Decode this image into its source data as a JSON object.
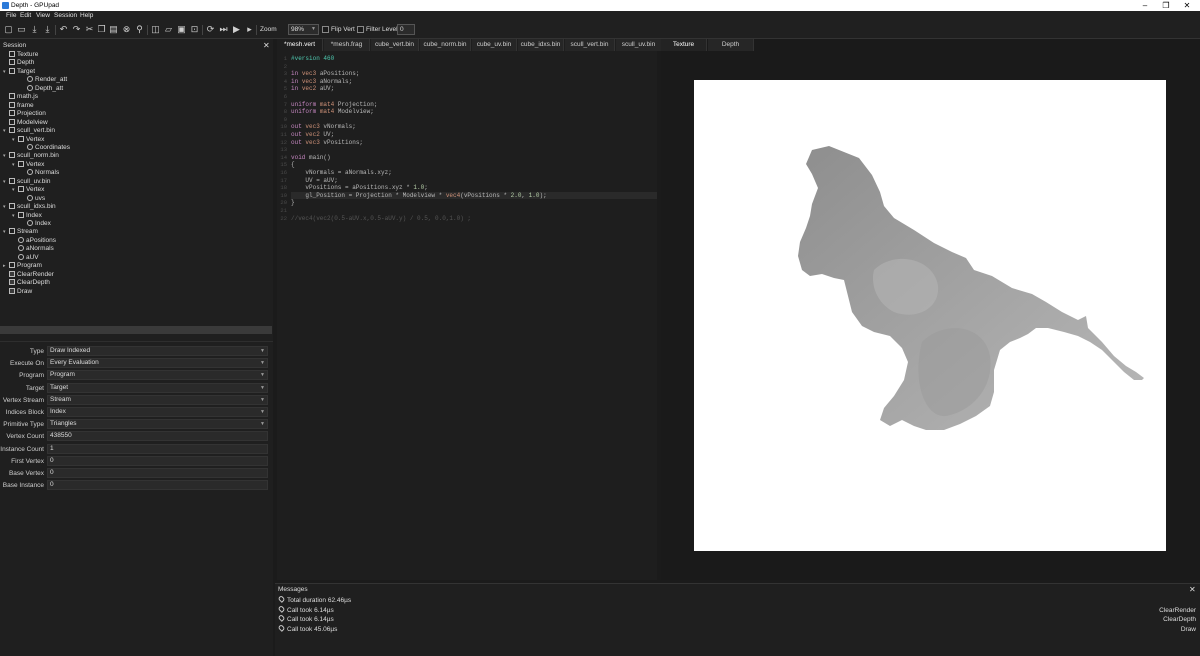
{
  "window": {
    "title": "Depth - GPUpad"
  },
  "menu": [
    "File",
    "Edit",
    "View",
    "Session",
    "Help"
  ],
  "toolbar": {
    "zoom_label": "Zoom",
    "zoom_value": "98%",
    "flip_vert": "Flip Vert",
    "filter": "Filter",
    "level_label": "Level",
    "level_value": "0"
  },
  "session": {
    "title": "Session",
    "items": [
      {
        "label": "Texture",
        "depth": 0,
        "icon": "texture-icon"
      },
      {
        "label": "Depth",
        "depth": 0,
        "icon": "texture-icon"
      },
      {
        "label": "Target",
        "depth": 0,
        "icon": "target-icon",
        "expanded": true
      },
      {
        "label": "Render_att",
        "depth": 2,
        "icon": "link-icon"
      },
      {
        "label": "Depth_att",
        "depth": 2,
        "icon": "link-icon"
      },
      {
        "label": "math.js",
        "depth": 0,
        "icon": "script-icon"
      },
      {
        "label": "frame",
        "depth": 0,
        "icon": "binding-icon"
      },
      {
        "label": "Projection",
        "depth": 0,
        "icon": "binding-icon"
      },
      {
        "label": "Modelview",
        "depth": 0,
        "icon": "binding-icon"
      },
      {
        "label": "scull_vert.bin",
        "depth": 0,
        "icon": "buffer-icon",
        "expanded": true
      },
      {
        "label": "Vertex",
        "depth": 1,
        "icon": "block-icon",
        "expanded": true
      },
      {
        "label": "Coordinates",
        "depth": 2,
        "icon": "link-icon"
      },
      {
        "label": "scull_norm.bin",
        "depth": 0,
        "icon": "buffer-icon",
        "expanded": true
      },
      {
        "label": "Vertex",
        "depth": 1,
        "icon": "block-icon",
        "expanded": true
      },
      {
        "label": "Normals",
        "depth": 2,
        "icon": "link-icon"
      },
      {
        "label": "scull_uv.bin",
        "depth": 0,
        "icon": "buffer-icon",
        "expanded": true
      },
      {
        "label": "Vertex",
        "depth": 1,
        "icon": "block-icon",
        "expanded": true
      },
      {
        "label": "uvs",
        "depth": 2,
        "icon": "link-icon"
      },
      {
        "label": "scull_idxs.bin",
        "depth": 0,
        "icon": "buffer-icon",
        "expanded": true
      },
      {
        "label": "Index",
        "depth": 1,
        "icon": "block-icon",
        "expanded": true
      },
      {
        "label": "Index",
        "depth": 2,
        "icon": "link-icon"
      },
      {
        "label": "Stream",
        "depth": 0,
        "icon": "stream-icon",
        "expanded": true
      },
      {
        "label": "aPositions",
        "depth": 1,
        "icon": "link-icon"
      },
      {
        "label": "aNormals",
        "depth": 1,
        "icon": "link-icon"
      },
      {
        "label": "aUV",
        "depth": 1,
        "icon": "link-icon"
      },
      {
        "label": "Program",
        "depth": 0,
        "icon": "program-icon",
        "collapsed": true
      },
      {
        "label": "ClearRender",
        "depth": 0,
        "icon": "check-icon"
      },
      {
        "label": "ClearDepth",
        "depth": 0,
        "icon": "check-icon"
      },
      {
        "label": "Draw",
        "depth": 0,
        "icon": "check-icon",
        "selected": true
      }
    ]
  },
  "properties": [
    {
      "label": "Type",
      "value": "Draw Indexed",
      "dropdown": true
    },
    {
      "label": "Execute On",
      "value": "Every Evaluation",
      "dropdown": true
    },
    {
      "label": "Program",
      "value": "Program",
      "dropdown": true
    },
    {
      "label": "Target",
      "value": "Target",
      "dropdown": true
    },
    {
      "label": "Vertex Stream",
      "value": "Stream",
      "dropdown": true
    },
    {
      "label": "Indices Block",
      "value": "Index",
      "dropdown": true
    },
    {
      "label": "Primitive Type",
      "value": "Triangles",
      "dropdown": true
    },
    {
      "label": "Vertex Count",
      "value": "438550",
      "dropdown": false
    },
    {
      "label": "Instance Count",
      "value": "1",
      "dropdown": false
    },
    {
      "label": "First Vertex",
      "value": "0",
      "dropdown": false
    },
    {
      "label": "Base Vertex",
      "value": "0",
      "dropdown": false
    },
    {
      "label": "Base Instance",
      "value": "0",
      "dropdown": false
    }
  ],
  "editor": {
    "tabs": [
      "*mesh.vert",
      "*mesh.frag",
      "cube_vert.bin",
      "cube_norm.bin",
      "cube_uv.bin",
      "cube_idxs.bin",
      "scull_vert.bin",
      "scull_uv.bin"
    ],
    "lines": [
      "#version 460",
      "",
      "in vec3 aPositions;",
      "in vec3 aNormals;",
      "in vec2 aUV;",
      "",
      "uniform mat4 Projection;",
      "uniform mat4 Modelview;",
      "",
      "out vec3 vNormals;",
      "out vec2 UV;",
      "out vec3 vPositions;",
      "",
      "void main()",
      "{",
      "    vNormals = aNormals.xyz;",
      "    UV = aUV;",
      "    vPositions = aPositions.xyz * 1.0;",
      "    gl_Position = Projection * Modelview * vec4(vPositions * 2.0, 1.0);",
      "}",
      "",
      "//vec4(vec2(0.5-aUV.x,0.5-aUV.y) / 0.5, 0.0,1.0) ;"
    ]
  },
  "viewer": {
    "tabs": [
      "Texture",
      "Depth"
    ]
  },
  "messages": {
    "title": "Messages",
    "rows": [
      {
        "text": "Total duration 62.46µs",
        "source": ""
      },
      {
        "text": "Call took 6.14µs",
        "source": "ClearRender"
      },
      {
        "text": "Call took 6.14µs",
        "source": "ClearDepth"
      },
      {
        "text": "Call took 45.06µs",
        "source": "Draw"
      }
    ]
  },
  "colors": {
    "background": "#1b1b1b",
    "panel": "#1f1f1f",
    "selection": "#3a3a3a",
    "keyword": "#c586c0",
    "string": "#ce9178",
    "number": "#b5cea8",
    "directive": "#4ec9b0"
  }
}
